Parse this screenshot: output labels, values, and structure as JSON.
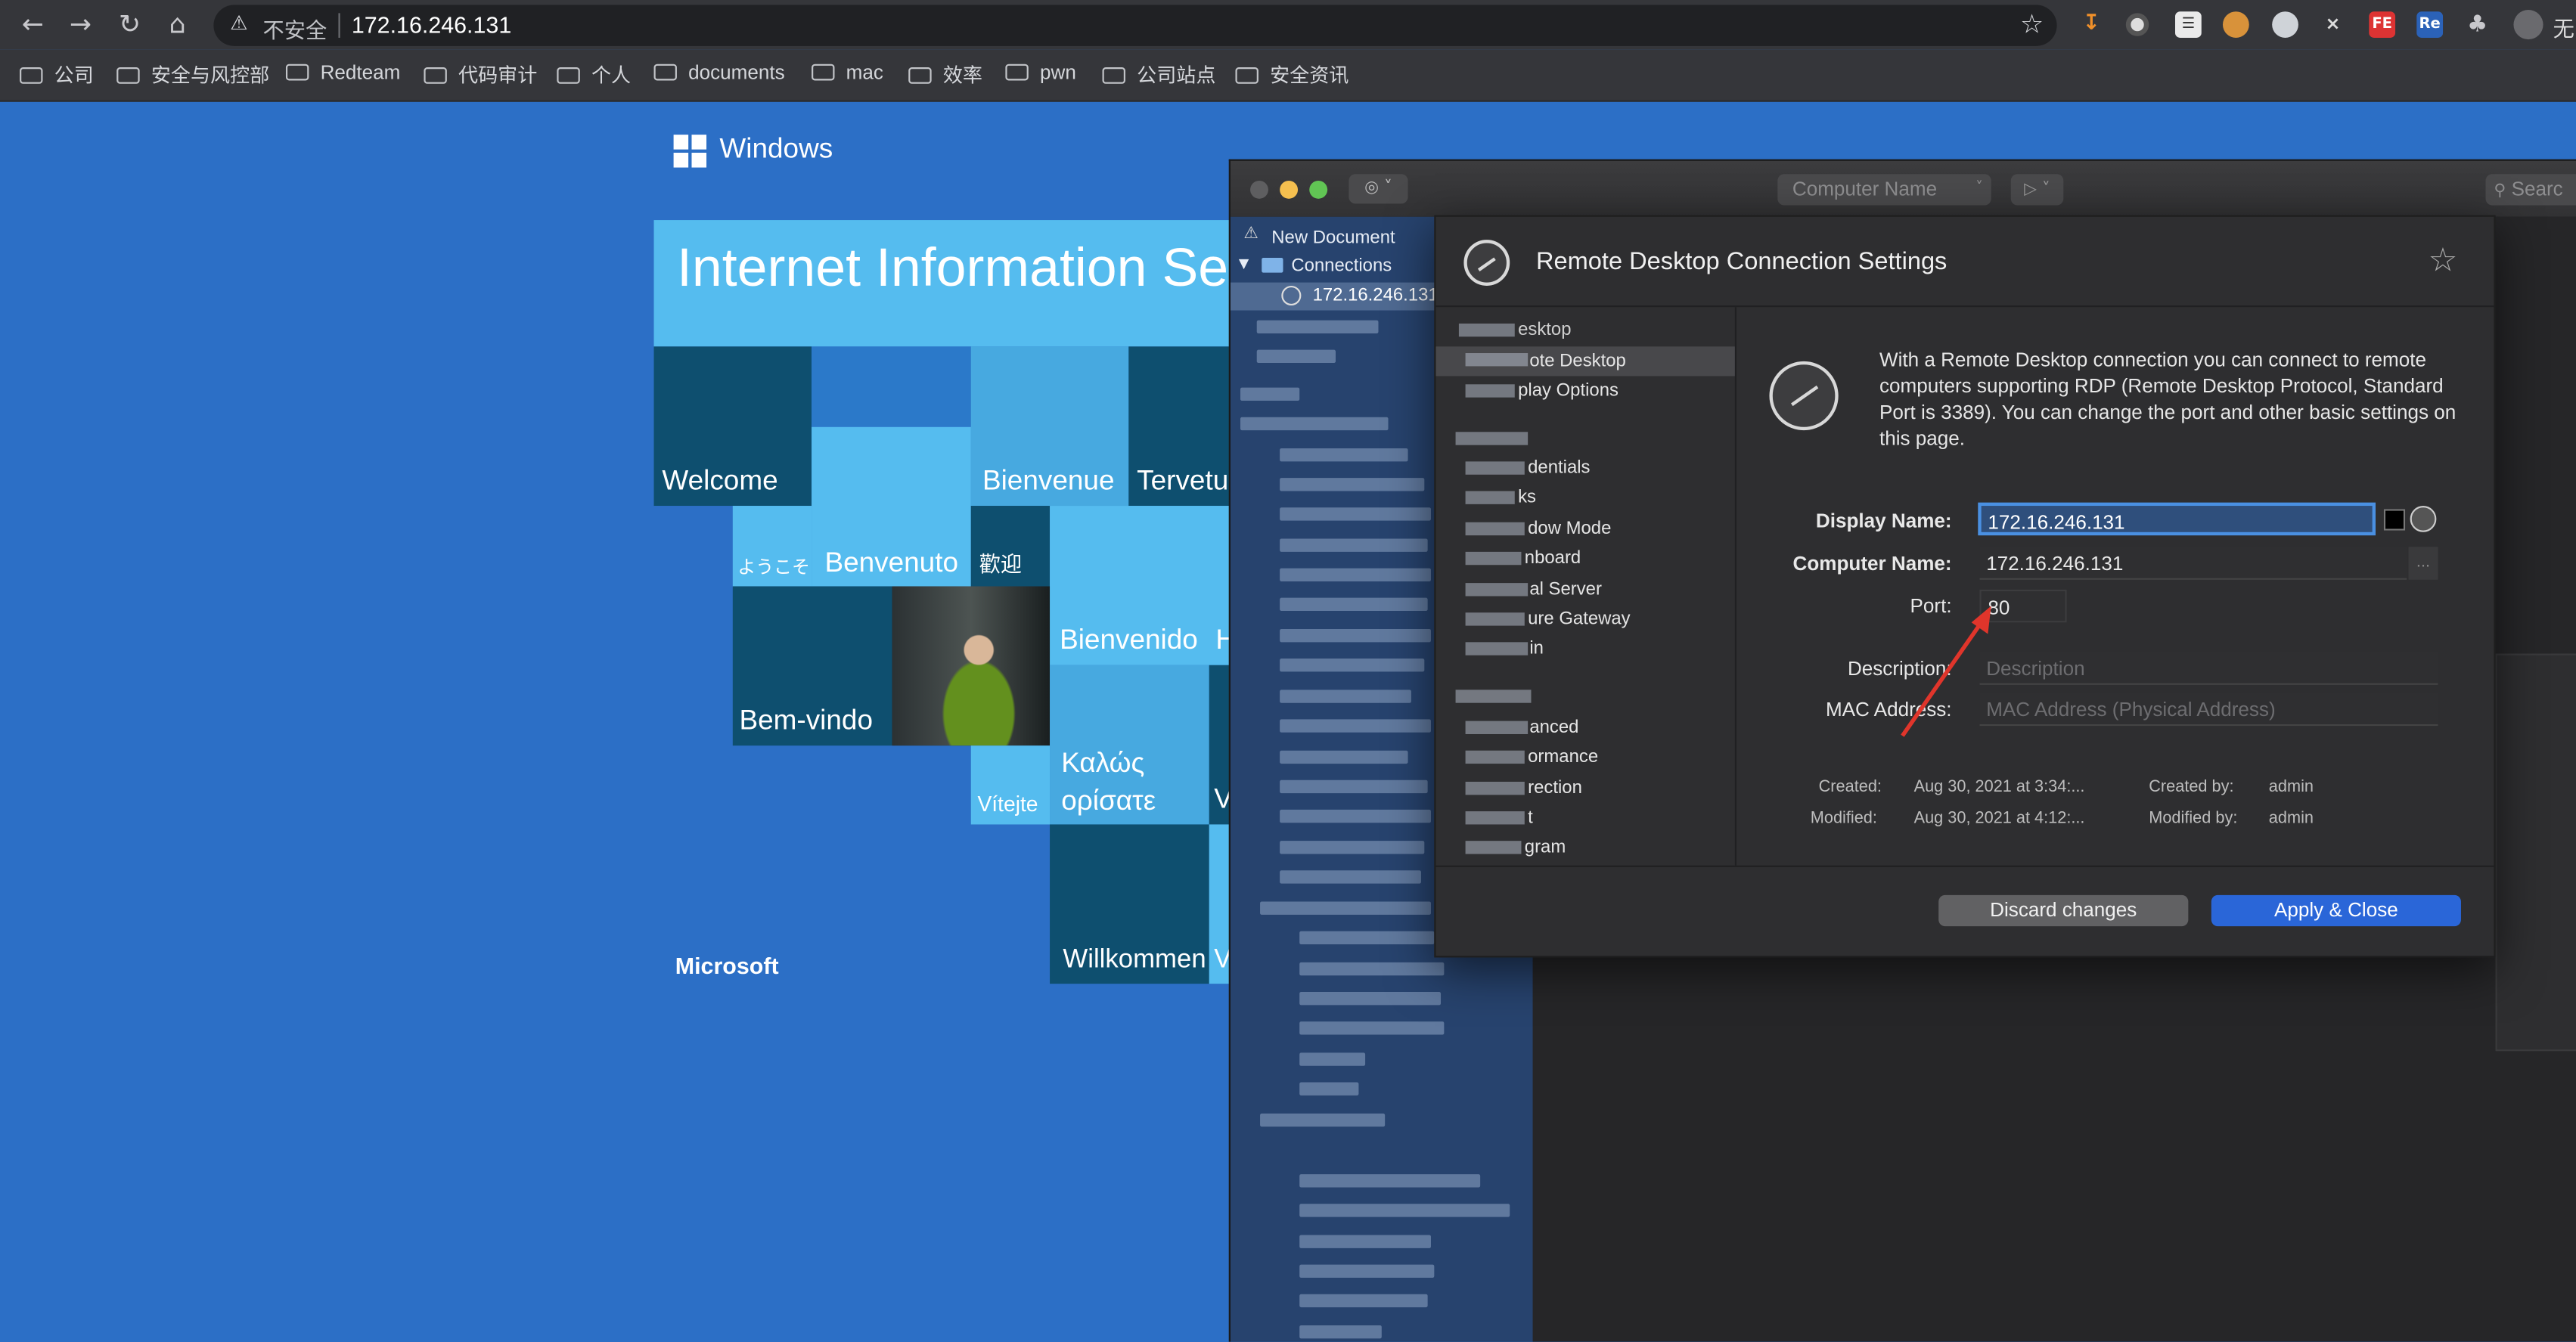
{
  "browser": {
    "insecure_label": "不安全",
    "url": "172.16.246.131",
    "partial_right_label": "无",
    "extensions": [
      "FE",
      "Re"
    ],
    "bookmarks": [
      "公司",
      "安全与风控部",
      "Redteam",
      "代码审计",
      "个人",
      "documents",
      "mac",
      "效率",
      "pwn",
      "公司站点",
      "安全资讯"
    ]
  },
  "iis": {
    "windows_label": "Windows",
    "banner_title": "Internet Information Ser",
    "microsoft_label": "Microsoft",
    "tiles": {
      "welcome": "Welcome",
      "bienvenue": "Bienvenue",
      "tervetu": "Tervetu",
      "youkoso": "ようこそ",
      "benvenuto": "Benvenuto",
      "huanying": "歡迎",
      "bienvenido": "Bienvenido",
      "h": "H",
      "bemvindo": "Bem-vindo",
      "vitejte": "Vítejte",
      "kalos_1": "Καλώς",
      "kalos_2": "ορίσατε",
      "v1": "V",
      "willkommen": "Willkommen",
      "v2": "V"
    }
  },
  "rdm": {
    "toolbar_dropdown": "Computer Name",
    "search_placeholder": "Searc",
    "sidebar": {
      "new_document": "New Document",
      "connections": "Connections",
      "selected_connection": "172.16.246.131"
    },
    "dialog": {
      "title": "Remote Desktop Connection Settings",
      "nav": {
        "header_desktop": "esktop",
        "remote_desktop": "ote Desktop",
        "display_options": "play Options",
        "credentials": "dentials",
        "ks": "ks",
        "window_mode": "dow Mode",
        "keyboard": "nboard",
        "terminal_server": "al Server",
        "secure_gateway": "ure Gateway",
        "login": "in",
        "advanced": "anced",
        "performance": "ormance",
        "redirection": "rection",
        "t": "t",
        "program": "gram"
      },
      "description": "With a Remote Desktop connection you can connect to remote computers supporting RDP (Remote Desktop Protocol, Standard Port is 3389). You can change the port and other basic settings on this page.",
      "display_name_label": "Display Name:",
      "display_name_value": "172.16.246.131",
      "computer_name_label": "Computer Name:",
      "computer_name_value": "172.16.246.131",
      "computer_name_more": "...",
      "port_label": "Port:",
      "port_value": "80",
      "description_label": "Description:",
      "description_placeholder": "Description",
      "mac_label": "MAC Address:",
      "mac_placeholder": "MAC Address (Physical Address)",
      "created_label": "Created:",
      "created_value": "Aug 30, 2021 at 3:34:...",
      "created_by_label": "Created by:",
      "created_by_value": "admin",
      "modified_label": "Modified:",
      "modified_value": "Aug 30, 2021 at 4:12:...",
      "modified_by_label": "Modified by:",
      "modified_by_value": "admin",
      "discard_button": "Discard changes",
      "apply_button": "Apply & Close"
    }
  },
  "colors": {
    "desktop_blue": "#2c6fc6",
    "tile_dark": "#0f4e6e",
    "tile_light": "#53b8ee",
    "apply_blue": "#2a66d8",
    "arrow_red": "#e0352b"
  }
}
